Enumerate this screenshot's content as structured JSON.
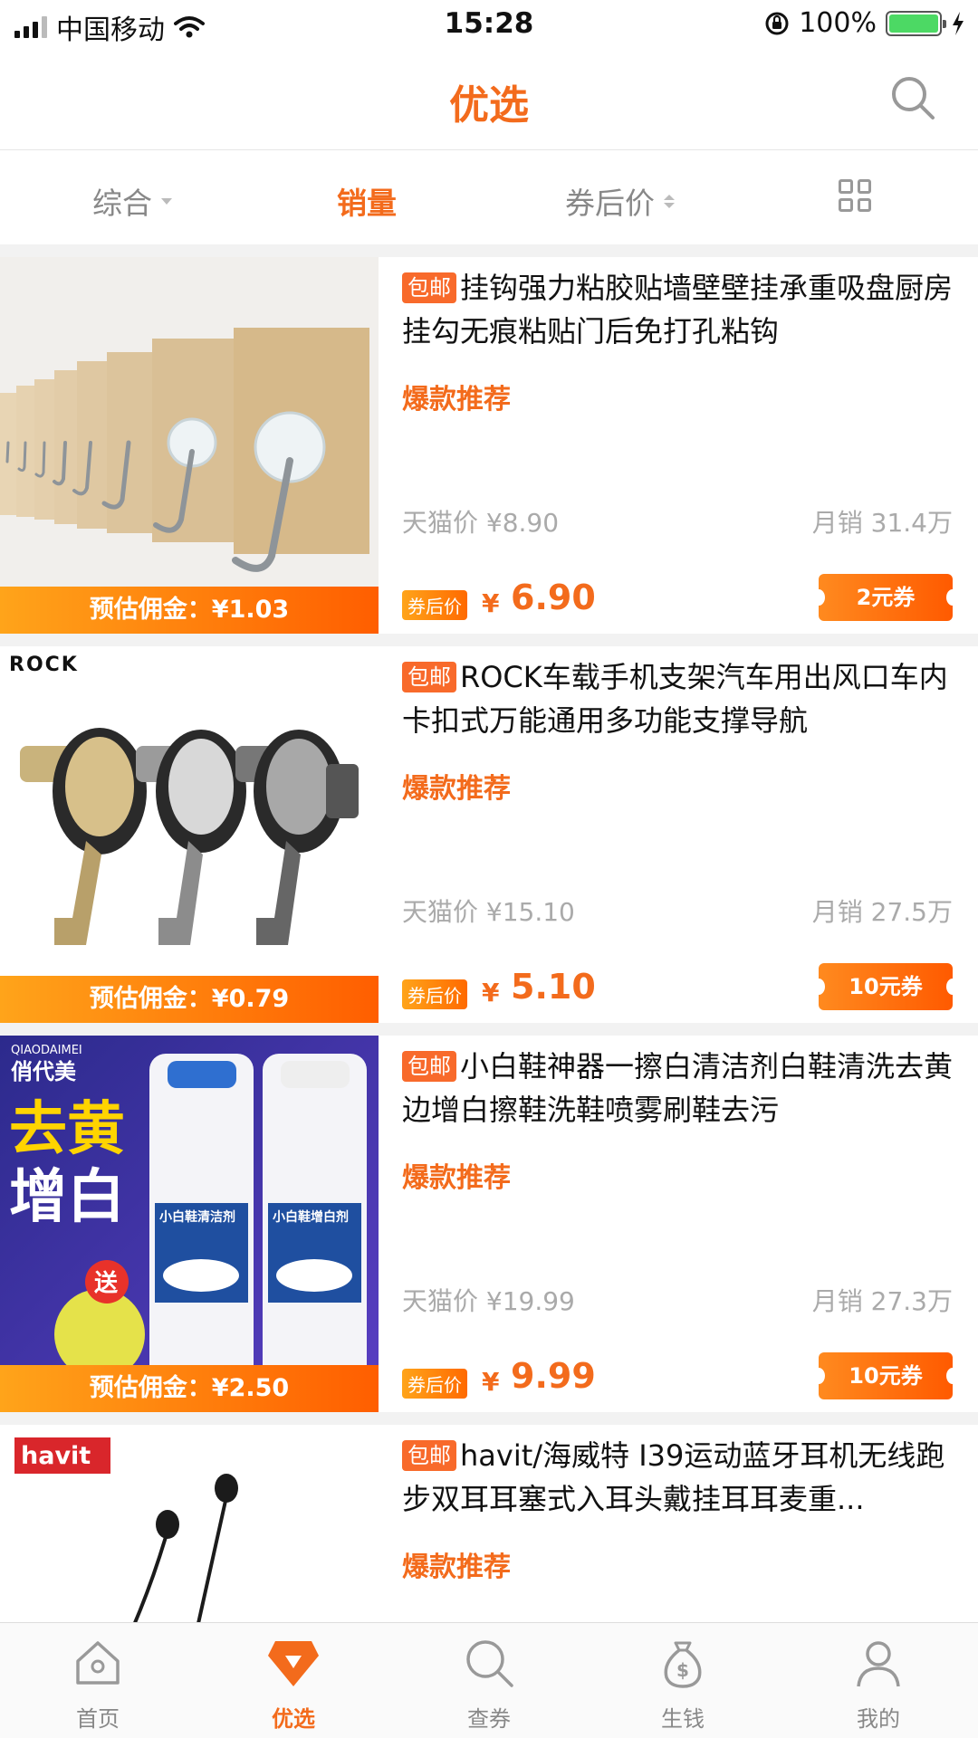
{
  "status": {
    "carrier": "中国移动",
    "time": "15:28",
    "battery": "100%",
    "icons": [
      "signal-icon",
      "wifi-icon",
      "orientation-lock-icon",
      "battery-icon",
      "charging-icon"
    ]
  },
  "header": {
    "title": "优选"
  },
  "sort": {
    "tabs": [
      "综合",
      "销量",
      "券后价"
    ],
    "active": "销量"
  },
  "products": [
    {
      "free_shipping": "包邮",
      "title": "挂钩强力粘胶贴墙壁壁挂承重吸盘厨房挂勾无痕粘贴门后免打孔粘钩",
      "hot": "爆款推荐",
      "tmall_price": "天猫价 ¥8.90",
      "monthly_sales": "月销 31.4万",
      "after_coupon_label": "券后价",
      "yen": "¥",
      "final_price": "6.90",
      "coupon": "2元券",
      "commission": "预估佣金：¥1.03"
    },
    {
      "free_shipping": "包邮",
      "title": "ROCK车载手机支架汽车用出风口车内卡扣式万能通用多功能支撑导航",
      "hot": "爆款推荐",
      "tmall_price": "天猫价 ¥15.10",
      "monthly_sales": "月销 27.5万",
      "after_coupon_label": "券后价",
      "yen": "¥",
      "final_price": "5.10",
      "coupon": "10元券",
      "commission": "预估佣金：¥0.79",
      "brand": "ROCK"
    },
    {
      "free_shipping": "包邮",
      "title": "小白鞋神器一擦白清洁剂白鞋清洗去黄边增白擦鞋洗鞋喷雾刷鞋去污",
      "hot": "爆款推荐",
      "tmall_price": "天猫价 ¥19.99",
      "monthly_sales": "月销 27.3万",
      "after_coupon_label": "券后价",
      "yen": "¥",
      "final_price": "9.99",
      "coupon": "10元券",
      "commission": "预估佣金：¥2.50",
      "brand_en": "QIAODAIMEI",
      "brand": "俏代美",
      "promo_line1": "去黄",
      "promo_line2": "增白",
      "gift": "送",
      "bottle1": "小白鞋清洁剂",
      "bottle2": "小白鞋增白剂"
    },
    {
      "free_shipping": "包邮",
      "title": "havit/海威特 I39运动蓝牙耳机无线跑步双耳耳塞式入耳头戴挂耳耳麦重...",
      "hot": "爆款推荐",
      "brand": "havit"
    }
  ],
  "tabbar": {
    "items": [
      "首页",
      "优选",
      "查券",
      "生钱",
      "我的"
    ],
    "active": "优选"
  },
  "colors": {
    "accent": "#f36b1c",
    "commission_start": "#ffa41a",
    "commission_end": "#ff5e00"
  }
}
